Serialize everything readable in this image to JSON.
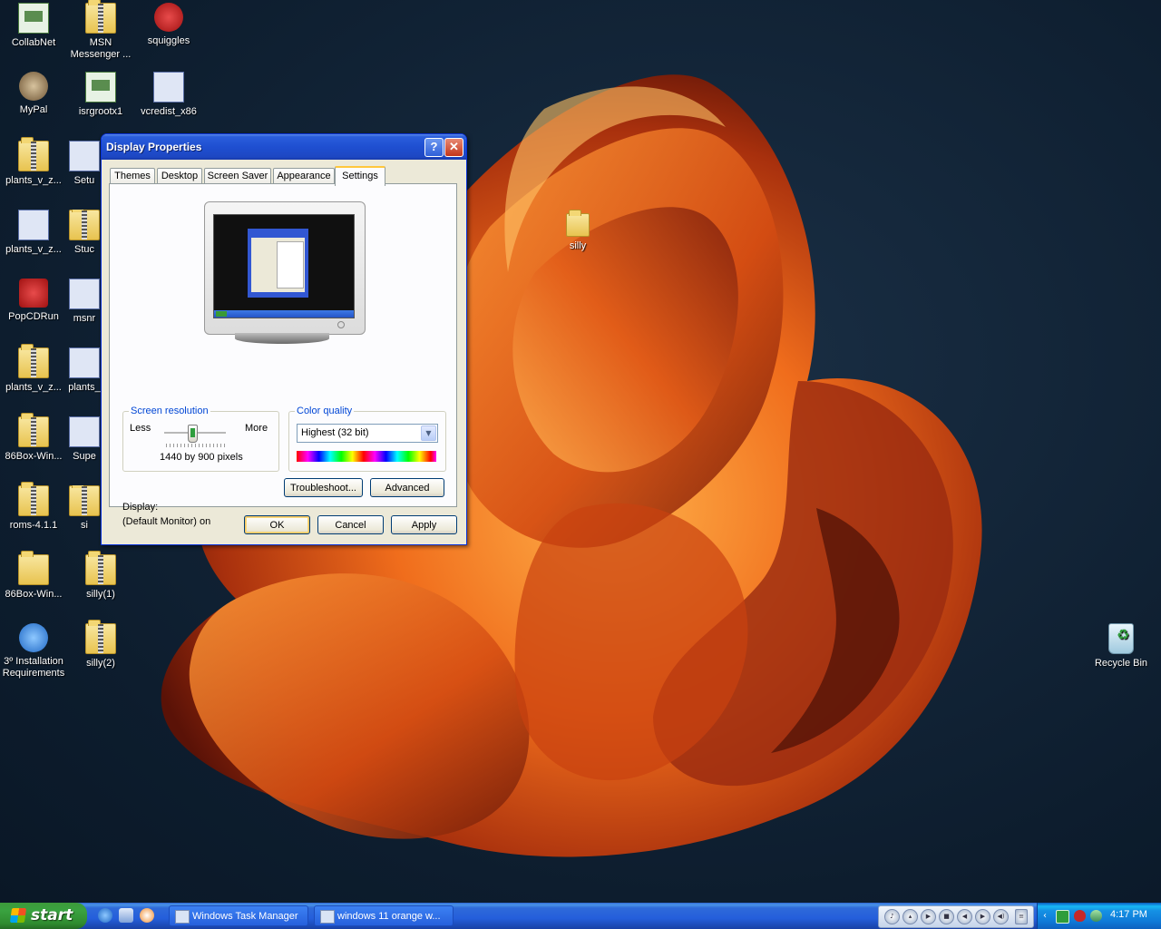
{
  "desktop": {
    "icons": [
      {
        "label": "CollabNet"
      },
      {
        "label": "MSN Messenger ..."
      },
      {
        "label": "squiggles"
      },
      {
        "label": "MyPal"
      },
      {
        "label": "isrgrootx1"
      },
      {
        "label": "vcredist_x86"
      },
      {
        "label": "plants_v_z..."
      },
      {
        "label": "Setu"
      },
      {
        "label": "plants_v_z..."
      },
      {
        "label": "Stuc"
      },
      {
        "label": "PopCDRun"
      },
      {
        "label": "msnr"
      },
      {
        "label": "plants_v_z..."
      },
      {
        "label": "plants_"
      },
      {
        "label": "86Box-Win..."
      },
      {
        "label": "Supe"
      },
      {
        "label": "roms-4.1.1"
      },
      {
        "label": "si"
      },
      {
        "label": "86Box-Win..."
      },
      {
        "label": "silly(1)"
      },
      {
        "label": "3º Installation Requirements"
      },
      {
        "label": "silly(2)"
      },
      {
        "label": "silly"
      },
      {
        "label": "Recycle Bin"
      }
    ]
  },
  "dialog": {
    "title": "Display Properties",
    "help_glyph": "?",
    "close_glyph": "✕",
    "tabs": [
      {
        "label": "Themes"
      },
      {
        "label": "Desktop"
      },
      {
        "label": "Screen Saver"
      },
      {
        "label": "Appearance"
      },
      {
        "label": "Settings",
        "active": true
      }
    ],
    "display_label": "Display:",
    "display_value": "(Default Monitor) on",
    "screen_resolution": {
      "title": "Screen resolution",
      "less": "Less",
      "more": "More",
      "value_text": "1440 by 900 pixels",
      "slider_level": 0.45
    },
    "color_quality": {
      "title": "Color quality",
      "selected": "Highest (32 bit)"
    },
    "buttons": {
      "troubleshoot": "Troubleshoot...",
      "advanced": "Advanced",
      "ok": "OK",
      "cancel": "Cancel",
      "apply": "Apply"
    }
  },
  "taskbar": {
    "start_label": "start",
    "tasks": [
      {
        "label": "Windows Task Manager"
      },
      {
        "label": "windows 11 orange w..."
      }
    ],
    "clock": "4:17 PM"
  },
  "colors": {
    "title_bar": "#1f4fd1",
    "taskbar": "#245edb",
    "start_button": "#3aa240",
    "active_tab_accent": "#ffc73c",
    "group_title": "#0046d5"
  }
}
